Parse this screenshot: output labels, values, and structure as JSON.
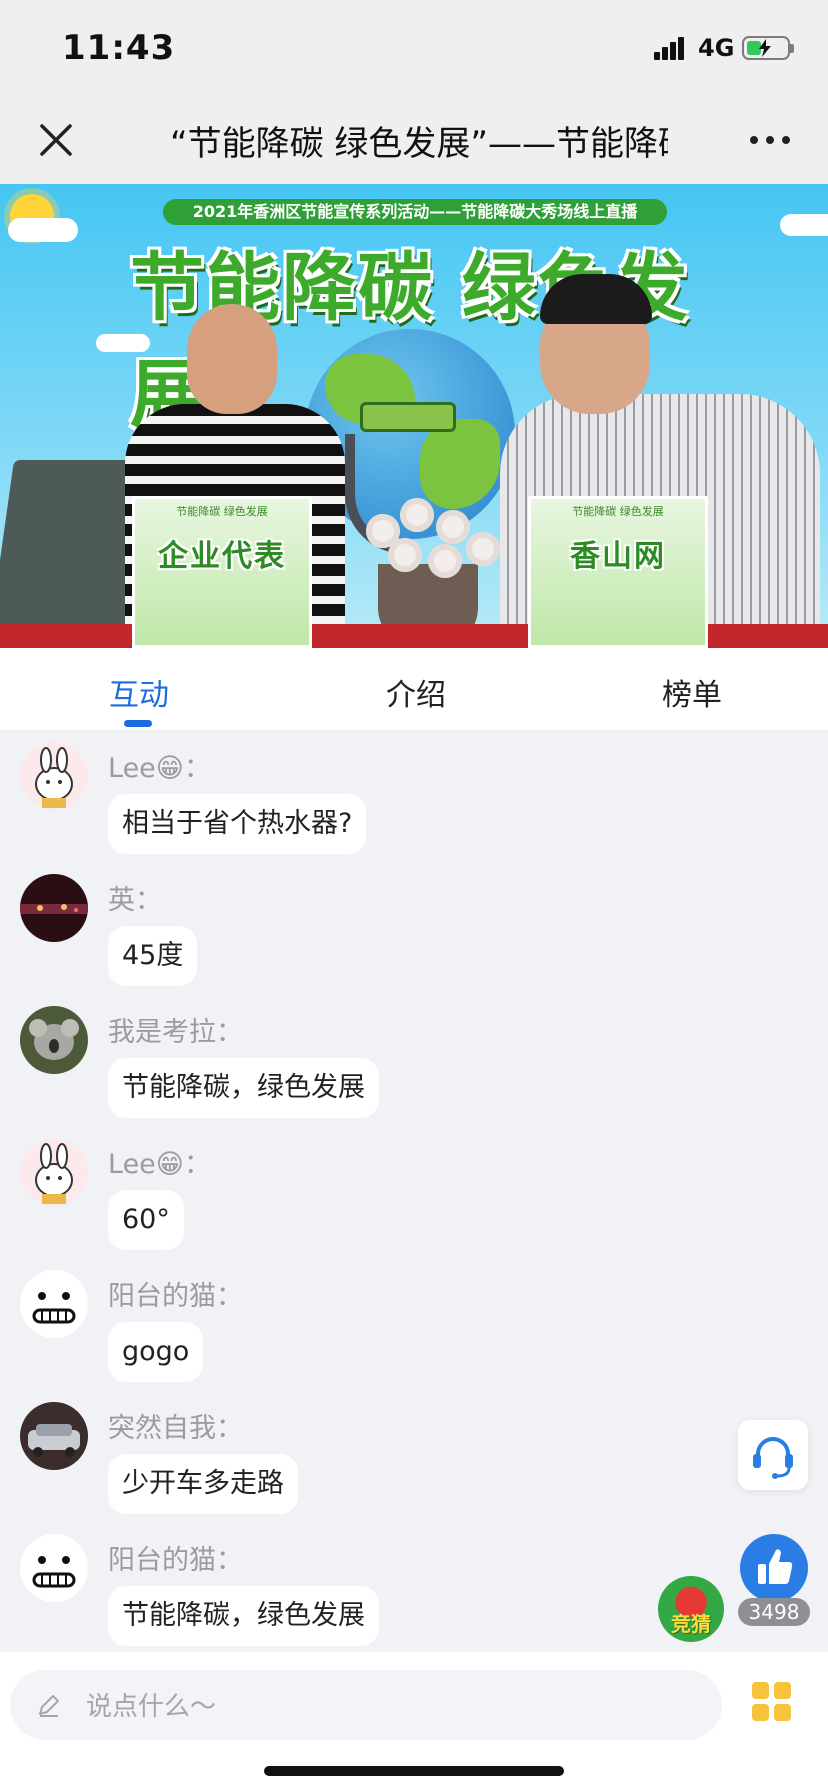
{
  "status_bar": {
    "time": "11:43",
    "network": "4G",
    "icons": [
      "signal-icon",
      "battery-charging-icon"
    ]
  },
  "navbar": {
    "title": "“节能降碳 绿色发展”——节能降碳大秀场线上直播",
    "icons": [
      "close-icon",
      "more-icon"
    ]
  },
  "banner": {
    "top_text": "2021年香洲区节能宣传系列活动——节能降碳大秀场线上直播",
    "title": "节能降碳 绿色发展",
    "left_plate_top": "节能降碳 绿色发展",
    "left_plate": "企业代表",
    "right_plate_top": "节能降碳 绿色发展",
    "right_plate": "香山网"
  },
  "tabs": [
    {
      "label": "互动",
      "active": true
    },
    {
      "label": "介绍",
      "active": false
    },
    {
      "label": "榜单",
      "active": false
    }
  ],
  "messages": [
    {
      "user": "Lee😁：",
      "text": "相当于省个热水器?",
      "avatar": "cartoon-dog"
    },
    {
      "user": "英：",
      "text": "45度",
      "avatar": "night-city"
    },
    {
      "user": "我是考拉：",
      "text": "节能降碳，绿色发展",
      "avatar": "koala"
    },
    {
      "user": "Lee😁：",
      "text": "60°",
      "avatar": "cartoon-dog"
    },
    {
      "user": "阳台的猫：",
      "text": "gogo",
      "avatar": "smiley-face"
    },
    {
      "user": "突然自我：",
      "text": "少开车多走路",
      "avatar": "car"
    },
    {
      "user": "阳台的猫：",
      "text": "节能降碳，绿色发展",
      "avatar": "smiley-face"
    }
  ],
  "floating": {
    "like_count": "3498",
    "guess_label": "竞猜"
  },
  "input": {
    "placeholder": "说点什么～"
  },
  "colors": {
    "accent": "#1c6de0",
    "like": "#2b7de6",
    "banner_green": "#3daa2b"
  }
}
